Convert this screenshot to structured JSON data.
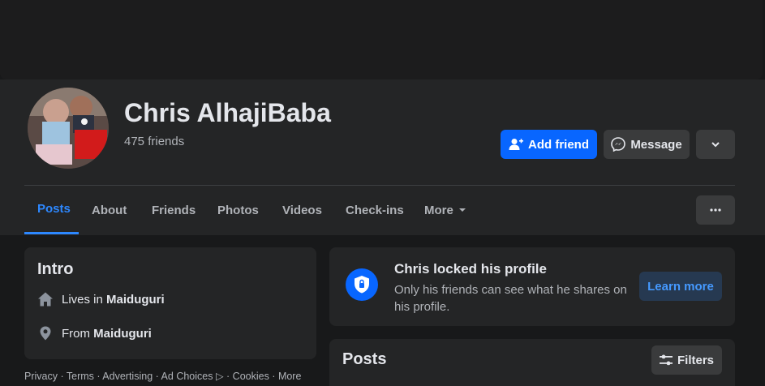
{
  "profile": {
    "name": "Chris AlhajiBaba",
    "friends_count": "475 friends"
  },
  "actions": {
    "add_friend": "Add friend",
    "message": "Message"
  },
  "tabs": [
    {
      "label": "Posts",
      "active": true
    },
    {
      "label": "About"
    },
    {
      "label": "Friends"
    },
    {
      "label": "Photos"
    },
    {
      "label": "Videos"
    },
    {
      "label": "Check-ins"
    },
    {
      "label": "More"
    }
  ],
  "intro": {
    "title": "Intro",
    "lives_prefix": "Lives in",
    "lives_place": "Maiduguri",
    "from_prefix": "From",
    "from_place": "Maiduguri"
  },
  "footer": {
    "text": "Privacy · Terms · Advertising · Ad Choices ▷ · Cookies · More"
  },
  "locked": {
    "title": "Chris locked his profile",
    "description": "Only his friends can see what he shares on his profile.",
    "learn_more": "Learn more"
  },
  "posts": {
    "title": "Posts",
    "filters": "Filters"
  },
  "colors": {
    "accent": "#0866ff",
    "tab_active": "#2d88ff",
    "background": "#18191a",
    "surface": "#242526"
  }
}
